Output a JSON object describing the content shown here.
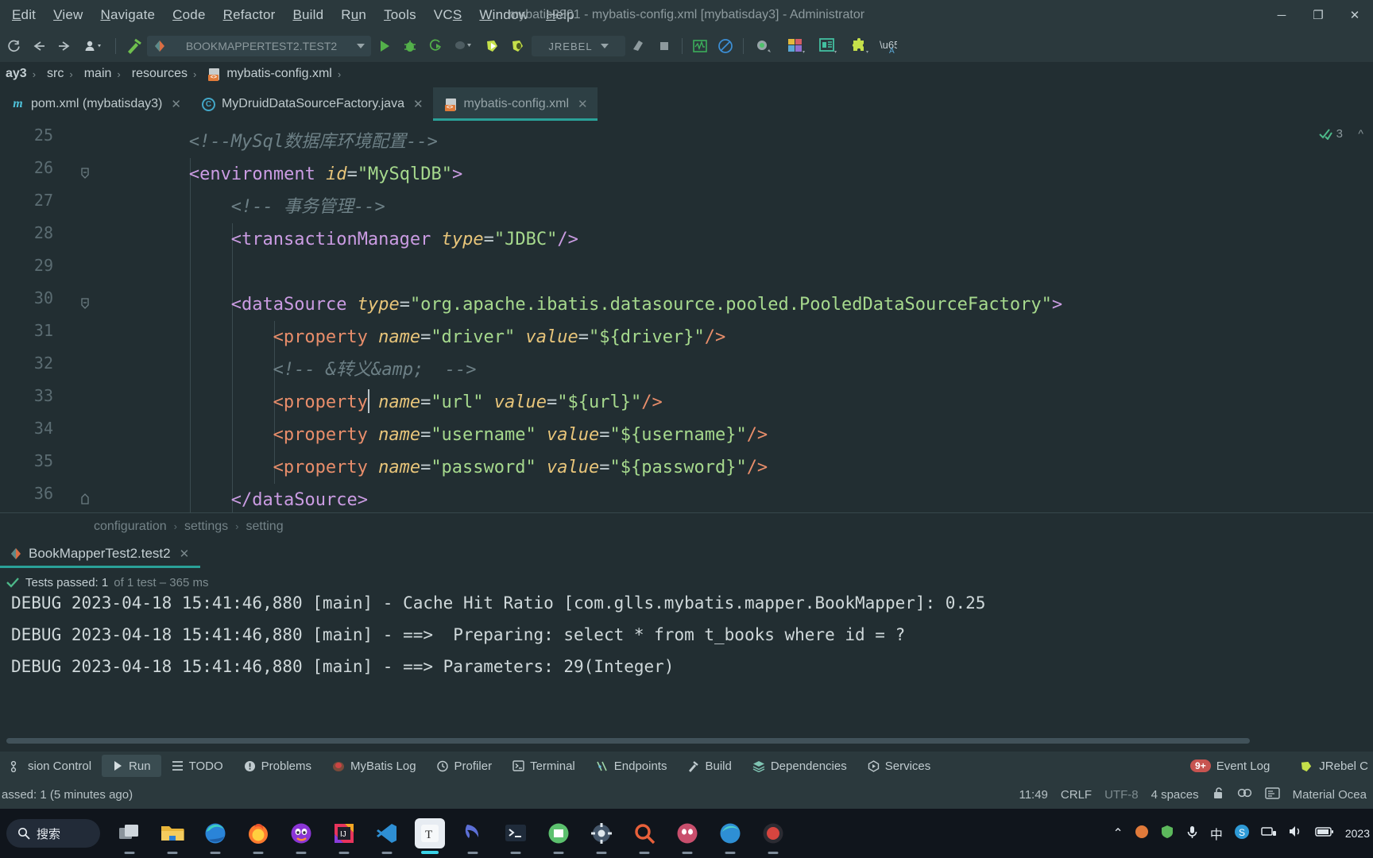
{
  "window": {
    "title": "mybatis2301 - mybatis-config.xml [mybatisday3] - Administrator",
    "minimize": "─",
    "maximize": "❐",
    "close": "✕"
  },
  "menubar": [
    {
      "label": "Edit",
      "mnemonic": "E"
    },
    {
      "label": "View",
      "mnemonic": "V"
    },
    {
      "label": "Navigate",
      "mnemonic": "N"
    },
    {
      "label": "Code",
      "mnemonic": "C"
    },
    {
      "label": "Refactor",
      "mnemonic": "R"
    },
    {
      "label": "Build",
      "mnemonic": "B"
    },
    {
      "label": "Run",
      "mnemonic": "u"
    },
    {
      "label": "Tools",
      "mnemonic": "T"
    },
    {
      "label": "VCS",
      "mnemonic": "S"
    },
    {
      "label": "Window",
      "mnemonic": "W"
    },
    {
      "label": "Help",
      "mnemonic": "H"
    }
  ],
  "toolbar": {
    "run_config": "BOOKMAPPERTEST2.TEST2",
    "jrebel_label": "JREBEL",
    "icons": [
      "refresh-icon",
      "back-arrow-icon",
      "forward-arrow-icon",
      "vcs-update-icon",
      "build-hammer-icon",
      "run-icon",
      "debug-icon",
      "run-coverage-icon",
      "profile-icon",
      "jrebel-run-icon",
      "jrebel-debug-icon",
      "stop-icon",
      "stop-square-icon",
      "monitor-icon",
      "no-entry-icon",
      "search-everywhere-icon",
      "database-icon",
      "structure-icon",
      "plugin-icon",
      "translate-icon"
    ]
  },
  "navbar": {
    "items": [
      "ay3",
      "src",
      "main",
      "resources",
      "mybatis-config.xml"
    ],
    "separator": "›"
  },
  "tabs": [
    {
      "label": "pom.xml (mybatisday3)",
      "icon": "maven-icon",
      "active": false
    },
    {
      "label": "MyDruidDataSourceFactory.java",
      "icon": "java-class-icon",
      "active": false
    },
    {
      "label": "mybatis-config.xml",
      "icon": "xml-file-icon",
      "active": true
    }
  ],
  "editor": {
    "inspection_count": "3",
    "lines": [
      {
        "num": "25",
        "indent": 1,
        "fold": null,
        "tokens": [
          {
            "t": "cmt",
            "v": "<!--MySql数据库环境配置-->"
          }
        ]
      },
      {
        "num": "26",
        "indent": 1,
        "fold": "minus",
        "tokens": [
          {
            "t": "tag",
            "v": "<environment "
          },
          {
            "t": "attr",
            "v": "id"
          },
          {
            "t": "punc",
            "v": "="
          },
          {
            "t": "val",
            "v": "\"MySqlDB\""
          },
          {
            "t": "tag",
            "v": ">"
          }
        ]
      },
      {
        "num": "27",
        "indent": 2,
        "fold": null,
        "tokens": [
          {
            "t": "cmt",
            "v": "<!-- 事务管理-->"
          }
        ]
      },
      {
        "num": "28",
        "indent": 2,
        "fold": null,
        "tokens": [
          {
            "t": "tag",
            "v": "<transactionManager "
          },
          {
            "t": "attr",
            "v": "type"
          },
          {
            "t": "punc",
            "v": "="
          },
          {
            "t": "val",
            "v": "\"JDBC\""
          },
          {
            "t": "tag",
            "v": "/>"
          }
        ]
      },
      {
        "num": "29",
        "indent": 0,
        "fold": null,
        "tokens": []
      },
      {
        "num": "30",
        "indent": 2,
        "fold": "minus",
        "tokens": [
          {
            "t": "tag",
            "v": "<dataSource "
          },
          {
            "t": "attr",
            "v": "type"
          },
          {
            "t": "punc",
            "v": "="
          },
          {
            "t": "val",
            "v": "\"org.apache.ibatis.datasource.pooled.PooledDataSourceFactory\""
          },
          {
            "t": "tag",
            "v": ">"
          }
        ]
      },
      {
        "num": "31",
        "indent": 3,
        "fold": null,
        "tokens": [
          {
            "t": "tag2",
            "v": "<property "
          },
          {
            "t": "attr",
            "v": "name"
          },
          {
            "t": "punc",
            "v": "="
          },
          {
            "t": "val",
            "v": "\"driver\""
          },
          {
            "t": "punc",
            "v": " "
          },
          {
            "t": "attr",
            "v": "value"
          },
          {
            "t": "punc",
            "v": "="
          },
          {
            "t": "val",
            "v": "\"${driver}\""
          },
          {
            "t": "tag2",
            "v": "/>"
          }
        ]
      },
      {
        "num": "32",
        "indent": 3,
        "fold": null,
        "tokens": [
          {
            "t": "cmt",
            "v": "<!-- &转义&amp;  -->"
          }
        ]
      },
      {
        "num": "33",
        "indent": 3,
        "fold": null,
        "tokens": [
          {
            "t": "tag2",
            "v": "<property "
          },
          {
            "t": "attr",
            "v": "name"
          },
          {
            "t": "punc",
            "v": "="
          },
          {
            "t": "val",
            "v": "\"url\""
          },
          {
            "t": "punc",
            "v": " "
          },
          {
            "t": "attr",
            "v": "value"
          },
          {
            "t": "punc",
            "v": "="
          },
          {
            "t": "val",
            "v": "\"${url}\""
          },
          {
            "t": "tag2",
            "v": "/>"
          }
        ]
      },
      {
        "num": "34",
        "indent": 3,
        "fold": null,
        "tokens": [
          {
            "t": "tag2",
            "v": "<property "
          },
          {
            "t": "attr",
            "v": "name"
          },
          {
            "t": "punc",
            "v": "="
          },
          {
            "t": "val",
            "v": "\"username\""
          },
          {
            "t": "punc",
            "v": " "
          },
          {
            "t": "attr",
            "v": "value"
          },
          {
            "t": "punc",
            "v": "="
          },
          {
            "t": "val",
            "v": "\"${username}\""
          },
          {
            "t": "tag2",
            "v": "/>"
          }
        ]
      },
      {
        "num": "35",
        "indent": 3,
        "fold": null,
        "tokens": [
          {
            "t": "tag2",
            "v": "<property "
          },
          {
            "t": "attr",
            "v": "name"
          },
          {
            "t": "punc",
            "v": "="
          },
          {
            "t": "val",
            "v": "\"password\""
          },
          {
            "t": "punc",
            "v": " "
          },
          {
            "t": "attr",
            "v": "value"
          },
          {
            "t": "punc",
            "v": "="
          },
          {
            "t": "val",
            "v": "\"${password}\""
          },
          {
            "t": "tag2",
            "v": "/>"
          }
        ]
      },
      {
        "num": "36",
        "indent": 2,
        "fold": "end",
        "tokens": [
          {
            "t": "tag",
            "v": "</dataSource>"
          }
        ]
      }
    ],
    "breadcrumb": [
      "configuration",
      "settings",
      "setting"
    ]
  },
  "run_window": {
    "tab_label": "BookMapperTest2.test2",
    "tab_close": "✕",
    "status_main": "Tests passed: 1",
    "status_sub": "of 1 test – 365 ms",
    "console_lines": [
      "DEBUG 2023-04-18 15:41:46,880 [main] - Cache Hit Ratio [com.glls.mybatis.mapper.BookMapper]: 0.25",
      "DEBUG 2023-04-18 15:41:46,880 [main] - ==>  Preparing: select * from t_books where id = ?",
      "DEBUG 2023-04-18 15:41:46,880 [main] - ==> Parameters: 29(Integer)"
    ]
  },
  "toolwindow_bar": {
    "items": [
      {
        "label": "sion Control",
        "icon": "version-control-icon",
        "active": false
      },
      {
        "label": "Run",
        "icon": "run-icon",
        "active": true
      },
      {
        "label": "TODO",
        "icon": "todo-icon",
        "active": false
      },
      {
        "label": "Problems",
        "icon": "problems-icon",
        "active": false
      },
      {
        "label": "MyBatis Log",
        "icon": "mybatis-log-icon",
        "active": false
      },
      {
        "label": "Profiler",
        "icon": "profiler-icon",
        "active": false
      },
      {
        "label": "Terminal",
        "icon": "terminal-icon",
        "active": false
      },
      {
        "label": "Endpoints",
        "icon": "endpoints-icon",
        "active": false
      },
      {
        "label": "Build",
        "icon": "build-hammer-icon",
        "active": false
      },
      {
        "label": "Dependencies",
        "icon": "dependencies-icon",
        "active": false
      },
      {
        "label": "Services",
        "icon": "services-icon",
        "active": false
      }
    ],
    "event_log": "Event Log",
    "event_badge": "9+",
    "jrebel_right": "JRebel C"
  },
  "statusbar": {
    "left": "assed: 1 (5 minutes ago)",
    "time": "11:49",
    "line_sep": "CRLF",
    "encoding": "UTF-8",
    "indent": "4 spaces",
    "lock_icon": "unlocked-icon",
    "theme": "Material Ocea"
  },
  "taskbar": {
    "search_label": "搜索",
    "apps": [
      {
        "name": "task-view-icon"
      },
      {
        "name": "file-explorer-icon"
      },
      {
        "name": "edge-browser-icon"
      },
      {
        "name": "firefox-browser-icon"
      },
      {
        "name": "discord-icon"
      },
      {
        "name": "intellij-idea-icon"
      },
      {
        "name": "vscode-icon"
      },
      {
        "name": "typora-icon"
      },
      {
        "name": "navicat-icon"
      },
      {
        "name": "postman-icon"
      },
      {
        "name": "windows-terminal-icon"
      },
      {
        "name": "settings-gear-icon"
      },
      {
        "name": "search-app-icon"
      },
      {
        "name": "qq-icon"
      },
      {
        "name": "edge-dev-icon"
      },
      {
        "name": "recorder-icon"
      }
    ],
    "tray": {
      "chevron": "⌃",
      "ime": "中",
      "clock_line1": "2023"
    }
  },
  "colors": {
    "accent": "#2aa198",
    "bg": "#222e32",
    "panel": "#2b393d",
    "tag": "#cb9ce3",
    "tag2": "#e98e6b",
    "attr": "#e8c57a",
    "value": "#a6d98d",
    "comment": "#6d8086"
  }
}
